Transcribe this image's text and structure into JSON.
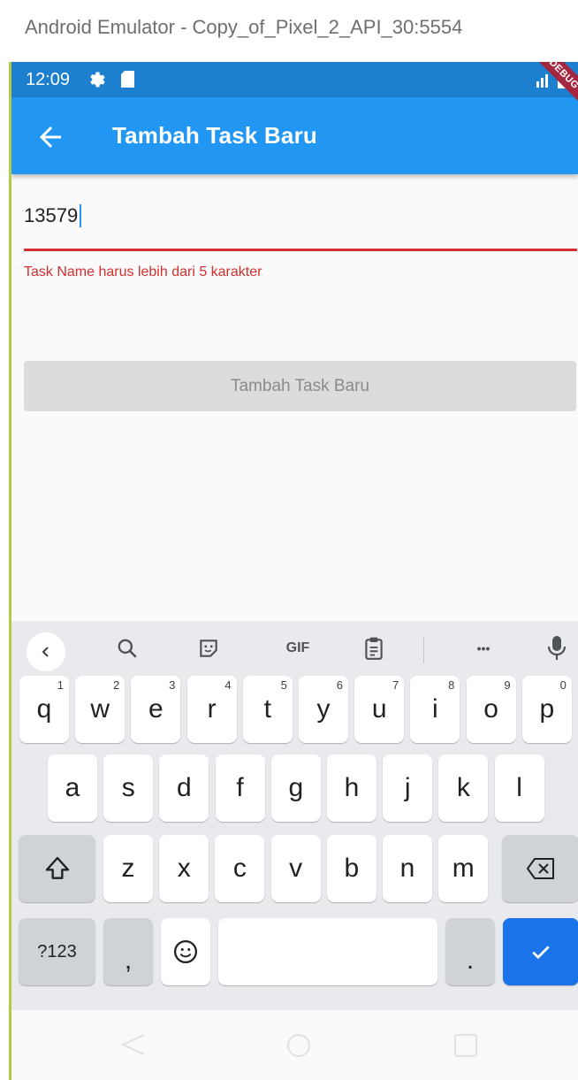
{
  "window": {
    "title": "Android Emulator - Copy_of_Pixel_2_API_30:5554"
  },
  "status_bar": {
    "time": "12:09",
    "debug_banner": "DEBUG"
  },
  "app_bar": {
    "title": "Tambah Task Baru",
    "back_icon": "arrow-back-icon"
  },
  "form": {
    "task_name_value": "13579",
    "error_text": "Task Name harus lebih dari 5 karakter",
    "submit_label": "Tambah Task Baru"
  },
  "keyboard": {
    "toolbar": {
      "gif_label": "GIF",
      "more_label": "•••"
    },
    "row1": [
      {
        "label": "q",
        "hint": "1"
      },
      {
        "label": "w",
        "hint": "2"
      },
      {
        "label": "e",
        "hint": "3"
      },
      {
        "label": "r",
        "hint": "4"
      },
      {
        "label": "t",
        "hint": "5"
      },
      {
        "label": "y",
        "hint": "6"
      },
      {
        "label": "u",
        "hint": "7"
      },
      {
        "label": "i",
        "hint": "8"
      },
      {
        "label": "o",
        "hint": "9"
      },
      {
        "label": "p",
        "hint": "0"
      }
    ],
    "row2": [
      "a",
      "s",
      "d",
      "f",
      "g",
      "h",
      "j",
      "k",
      "l"
    ],
    "row3": [
      "z",
      "x",
      "c",
      "v",
      "b",
      "n",
      "m"
    ],
    "row4": {
      "symbols_label": "?123",
      "comma_label": ",",
      "period_label": "."
    }
  },
  "colors": {
    "app_bar": "#2196f3",
    "status_bar": "#1d7fcf",
    "error": "#d32f2f",
    "keyboard_action": "#1a73e8"
  }
}
